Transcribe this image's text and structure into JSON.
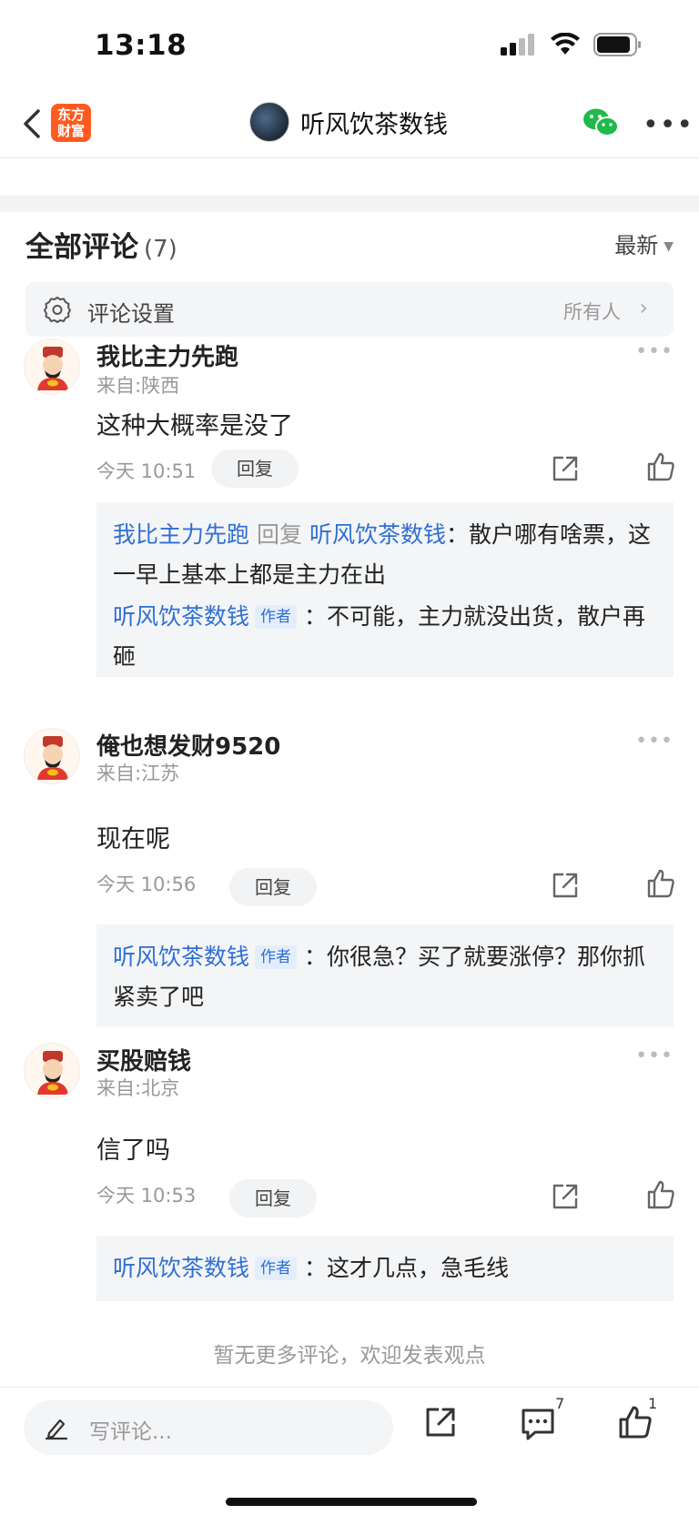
{
  "status": {
    "time": "13:18"
  },
  "nav": {
    "logo_line1": "东方",
    "logo_line2": "财富",
    "title": "听风饮茶数钱"
  },
  "section": {
    "title": "全部评论",
    "count": "(7)",
    "sort": "最新"
  },
  "settings": {
    "label": "评论设置",
    "value": "所有人"
  },
  "comments": [
    {
      "user": "我比主力先跑",
      "location": "来自:陕西",
      "text": "这种大概率是没了",
      "time": "今天 10:51",
      "reply_label": "回复",
      "replies": [
        {
          "from": "我比主力先跑",
          "connector": "回复",
          "to": "听风饮茶数钱",
          "sep": "：",
          "text": "散户哪有啥票，这一早上基本上都是主力在出"
        },
        {
          "from": "听风饮茶数钱",
          "tag": "作者",
          "sep": "：",
          "text": "不可能，主力就没出货，散户再砸"
        }
      ]
    },
    {
      "user": "俺也想发财9520",
      "location": "来自:江苏",
      "text": "现在呢",
      "time": "今天 10:56",
      "reply_label": "回复",
      "replies": [
        {
          "from": "听风饮茶数钱",
          "tag": "作者",
          "sep": "：",
          "text": "你很急？买了就要涨停？那你抓紧卖了吧"
        }
      ]
    },
    {
      "user": "买股赔钱",
      "location": "来自:北京",
      "text": "信了吗",
      "time": "今天 10:53",
      "reply_label": "回复",
      "replies": [
        {
          "from": "听风饮茶数钱",
          "tag": "作者",
          "sep": "：",
          "text": "这才几点，急毛线"
        }
      ]
    }
  ],
  "footer_note": "暂无更多评论，欢迎发表观点",
  "bottom": {
    "placeholder": "写评论...",
    "comment_count": "7",
    "like_count": "1"
  },
  "colors": {
    "link_blue": "#2f6fd4",
    "brand_orange": "#ff5a1f",
    "wechat_green": "#1fba4a"
  }
}
